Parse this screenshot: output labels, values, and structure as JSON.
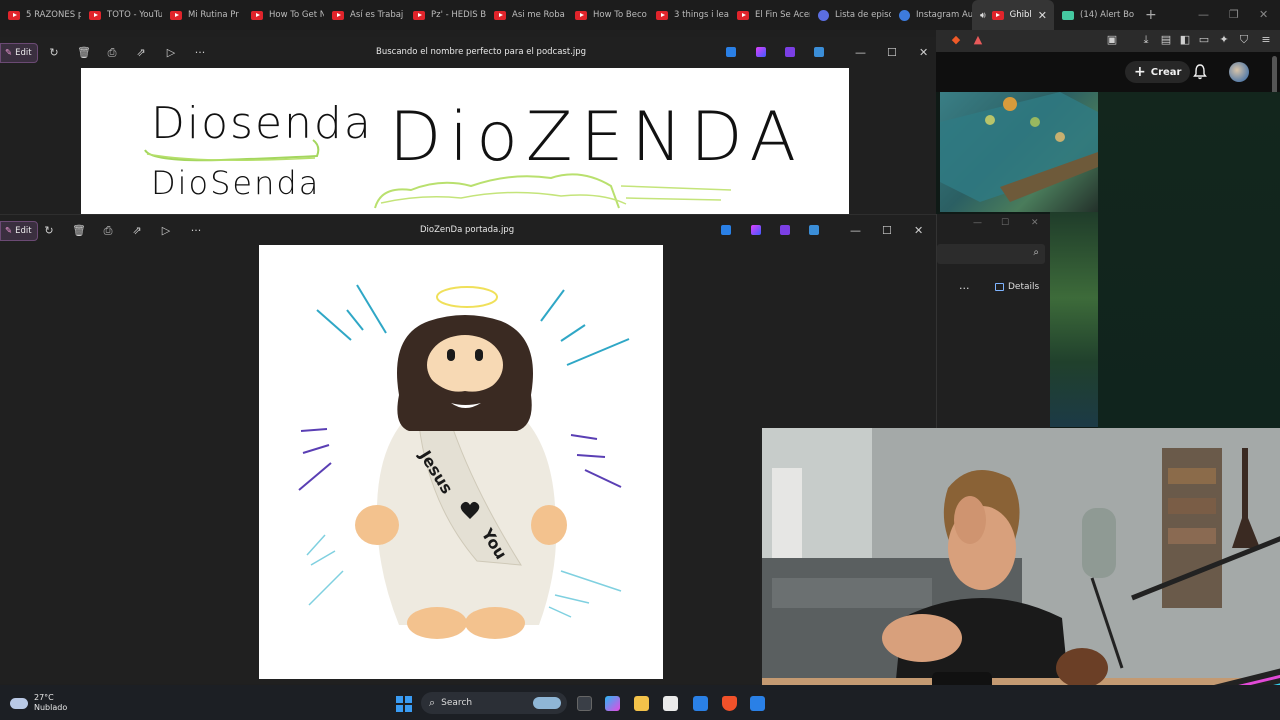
{
  "browser": {
    "tabs": [
      {
        "label": "5 RAZONES p",
        "icon": "youtube-icon"
      },
      {
        "label": "TOTO - YouTu",
        "icon": "youtube-icon"
      },
      {
        "label": "Mi Rutina Pr",
        "icon": "youtube-icon"
      },
      {
        "label": "How To Get N",
        "icon": "youtube-icon"
      },
      {
        "label": "Así es Trabaj",
        "icon": "youtube-icon"
      },
      {
        "label": "Pz' - HEDIS B",
        "icon": "youtube-icon"
      },
      {
        "label": "Asi me Roba",
        "icon": "youtube-icon"
      },
      {
        "label": "How To Beco",
        "icon": "youtube-icon"
      },
      {
        "label": "3 things i lea",
        "icon": "youtube-icon"
      },
      {
        "label": "El Fin Se Acer",
        "icon": "youtube-icon"
      },
      {
        "label": "Lista de episo",
        "icon": "podcast-icon"
      },
      {
        "label": "Instagram Au",
        "icon": "instagram-icon"
      },
      {
        "label": "Ghibl",
        "icon": "speaker-icon",
        "active": true
      },
      {
        "label": "(14) Alert Bo",
        "icon": "alert-icon"
      }
    ],
    "youtube": {
      "create_label": "Crear"
    },
    "explorer": {
      "details_label": "Details"
    }
  },
  "photos_window_1": {
    "edit_label": "Edit",
    "title": "Buscando el nombre perfecto para el podcast.jpg",
    "handwriting": [
      "Diosenda",
      "DioZENDA",
      "DioSenda"
    ]
  },
  "photos_window_2": {
    "edit_label": "Edit",
    "title": "DioZenDa portada.jpg",
    "figure_sash_text": [
      "Jesus",
      "You"
    ]
  },
  "taskbar": {
    "temperature": "27°C",
    "weather": "Nublado",
    "search_label": "Search"
  },
  "colors": {
    "photos_bg": "#202020",
    "accent_edit": "#6b4a74",
    "youtube_red": "#e0242b",
    "taskbar_bg": "#1c1f24"
  }
}
